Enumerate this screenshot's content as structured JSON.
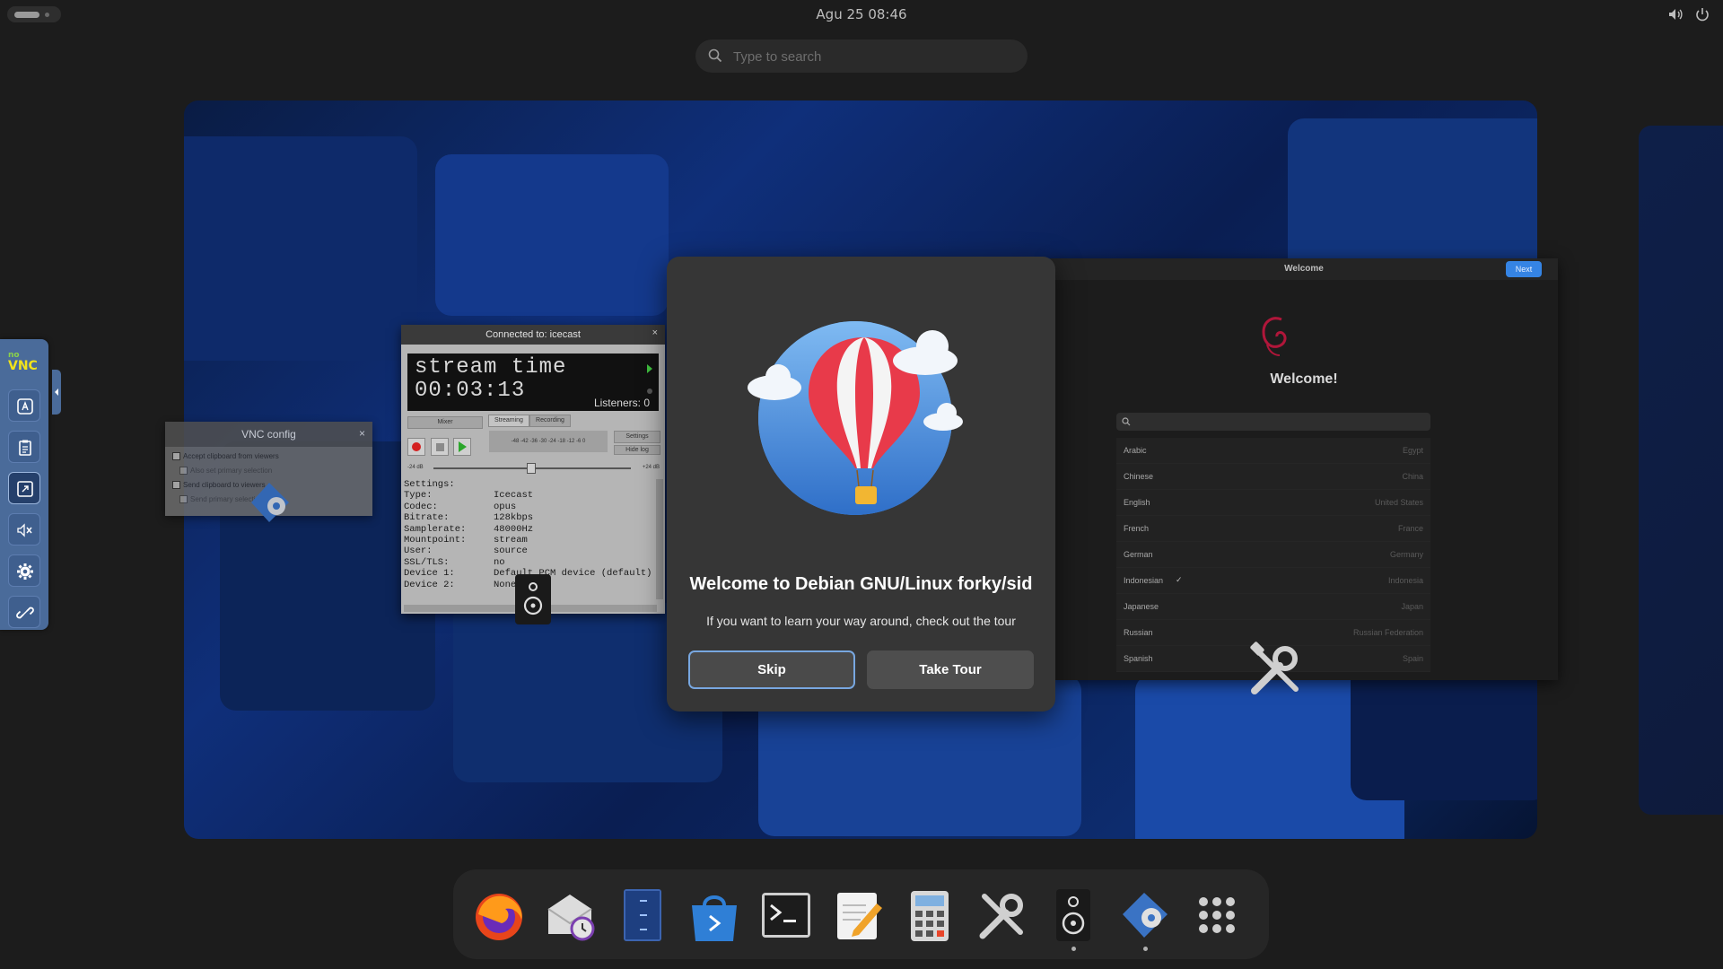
{
  "topbar": {
    "clock": "Agu 25  08:46",
    "icons": [
      "volume-icon",
      "power-icon"
    ]
  },
  "search": {
    "placeholder": "Type to search"
  },
  "vnc_sidebar": {
    "logo_top": "no",
    "logo": "VNC",
    "buttons": [
      "keyboard-icon",
      "clipboard-icon",
      "fullscreen-icon",
      "mute-icon",
      "settings-icon",
      "disconnect-icon"
    ]
  },
  "vnc_config": {
    "title": "VNC config",
    "close": "×",
    "options": [
      "Accept clipboard from viewers",
      "Also set primary selection",
      "Send clipboard to viewers",
      "Send primary selection"
    ]
  },
  "icecast": {
    "title": "Connected to: icecast",
    "close": "×",
    "lcd_line1": "stream time",
    "lcd_line2": "00:03:13",
    "listeners": "Listeners: 0",
    "tabs": {
      "mixer": "Mixer",
      "streaming": "Streaming",
      "recording": "Recording",
      "settings": "Settings",
      "hide_log": "Hide log"
    },
    "meter_scale": "-48 -42 -36 -30 -24 -18 -12 -6 0",
    "gain_left": "-24 dB",
    "gain_right": "+24 dB",
    "settings": [
      [
        "Settings:",
        ""
      ],
      [
        "Type:",
        "Icecast"
      ],
      [
        "Codec:",
        "opus"
      ],
      [
        "Bitrate:",
        "128kbps"
      ],
      [
        "Samplerate:",
        "48000Hz"
      ],
      [
        "Mountpoint:",
        "stream"
      ],
      [
        "User:",
        "source"
      ],
      [
        "SSL/TLS:",
        "no"
      ],
      [
        "Device 1:",
        "Default PCM device (default)"
      ],
      [
        "Device 2:",
        "None"
      ]
    ]
  },
  "welcome_window": {
    "title": "Welcome",
    "next": "Next",
    "heading": "Welcome!",
    "languages": [
      {
        "name": "Arabic",
        "country": "Egypt"
      },
      {
        "name": "Chinese",
        "country": "China"
      },
      {
        "name": "English",
        "country": "United States"
      },
      {
        "name": "French",
        "country": "France"
      },
      {
        "name": "German",
        "country": "Germany"
      },
      {
        "name": "Indonesian",
        "country": "Indonesia",
        "selected": true
      },
      {
        "name": "Japanese",
        "country": "Japan"
      },
      {
        "name": "Russian",
        "country": "Russian Federation"
      },
      {
        "name": "Spanish",
        "country": "Spain"
      }
    ]
  },
  "dialog": {
    "title": "Welcome to Debian GNU/Linux forky/sid",
    "subtitle": "If you want to learn your way around, check out the tour",
    "skip": "Skip",
    "take_tour": "Take Tour"
  },
  "dock": {
    "apps": [
      "firefox-icon",
      "evolution-mail-icon",
      "file-manager-icon",
      "software-store-icon",
      "terminal-icon",
      "text-editor-icon",
      "calculator-icon",
      "settings-tools-icon",
      "speaker-app-icon",
      "debian-installer-icon",
      "show-apps-icon"
    ],
    "running": [
      "speaker-app-icon",
      "debian-installer-icon"
    ]
  },
  "colors": {
    "accent": "#3584e4",
    "dialog_bg": "#363636",
    "workspace_blue": "#0f2f7a",
    "vnc_bar": "#4a6b9a"
  }
}
